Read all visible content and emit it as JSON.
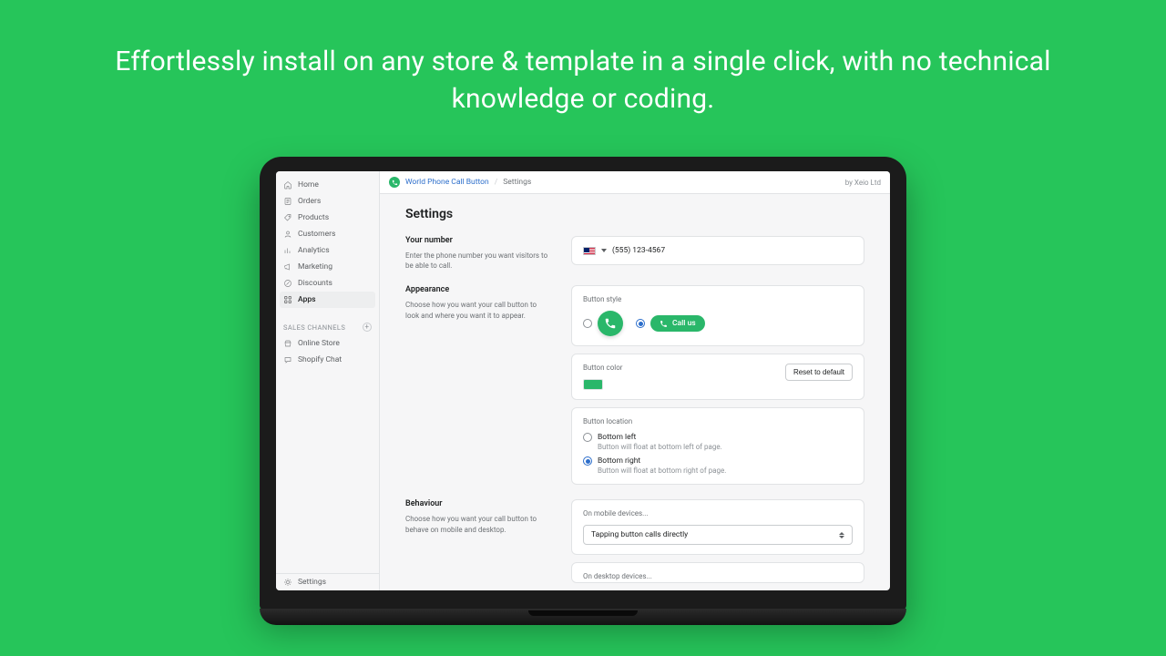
{
  "hero": "Effortlessly install on any store & template in a single click, with no technical knowledge or coding.",
  "topbar": {
    "app_name": "World Phone Call Button",
    "crumb": "Settings",
    "byline": "by Xeio Ltd"
  },
  "sidebar": {
    "items": [
      {
        "label": "Home"
      },
      {
        "label": "Orders"
      },
      {
        "label": "Products"
      },
      {
        "label": "Customers"
      },
      {
        "label": "Analytics"
      },
      {
        "label": "Marketing"
      },
      {
        "label": "Discounts"
      },
      {
        "label": "Apps"
      }
    ],
    "section_label": "SALES CHANNELS",
    "channels": [
      {
        "label": "Online Store"
      },
      {
        "label": "Shopify Chat"
      }
    ],
    "footer": {
      "label": "Settings"
    }
  },
  "page": {
    "title": "Settings",
    "number": {
      "heading": "Your number",
      "help": "Enter the phone number you want visitors to be able to call.",
      "value": "(555) 123-4567"
    },
    "appearance": {
      "heading": "Appearance",
      "help": "Choose how you want your call button to look and where you want it to appear.",
      "style_label": "Button style",
      "pill_text": "Call us",
      "color_label": "Button color",
      "color_hex": "#2ab76a",
      "reset_label": "Reset to default",
      "location_label": "Button location",
      "options": [
        {
          "title": "Bottom left",
          "sub": "Button will float at bottom left of page.",
          "checked": false
        },
        {
          "title": "Bottom right",
          "sub": "Button will float at bottom right of page.",
          "checked": true
        }
      ]
    },
    "behaviour": {
      "heading": "Behaviour",
      "help": "Choose how you want your call button to behave on mobile and desktop.",
      "mobile_label": "On mobile devices...",
      "mobile_value": "Tapping button calls directly",
      "desktop_label": "On desktop devices..."
    }
  }
}
